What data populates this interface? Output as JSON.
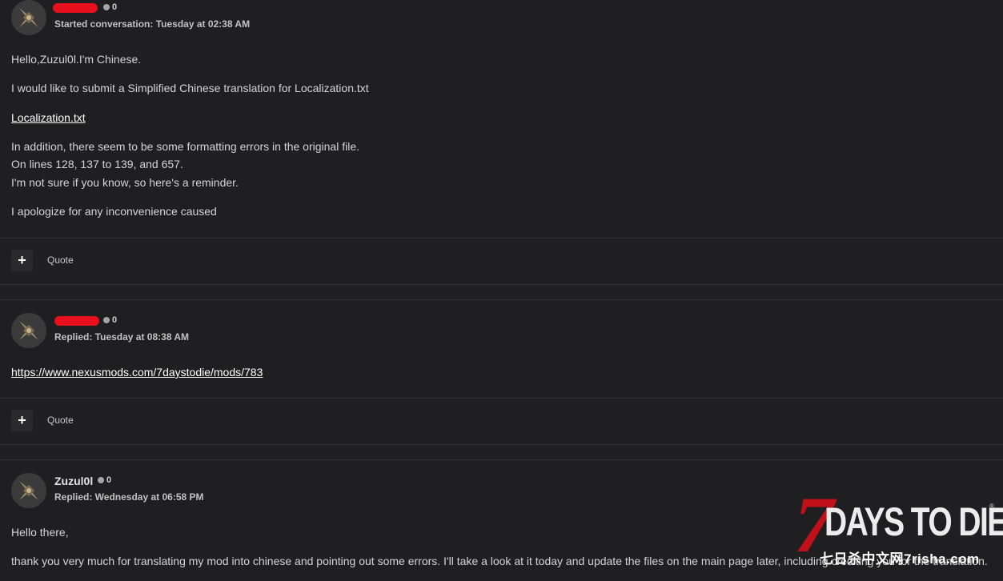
{
  "posts": [
    {
      "author": "",
      "reactions": "0",
      "meta": "Started conversation: Tuesday at 02:38 AM",
      "paragraphs": [
        "Hello,Zuzul0l.I'm Chinese.",
        "I would like to submit a Simplified Chinese translation for Localization.txt"
      ],
      "attachment_link": "Localization.txt",
      "body_lines": [
        "In addition, there seem to be some formatting errors in the original file.",
        "On lines 128, 137 to 139, and 657.",
        "I'm not sure if you know, so here's a reminder."
      ],
      "closing": "I apologize for any inconvenience caused",
      "plus_label": "+",
      "quote_label": "Quote"
    },
    {
      "author": "",
      "reactions": "0",
      "meta": "Replied: Tuesday at 08:38 AM",
      "link": "https://www.nexusmods.com/7daystodie/mods/783",
      "plus_label": "+",
      "quote_label": "Quote"
    },
    {
      "author": "Zuzul0l",
      "reactions": "0",
      "meta": "Replied: Wednesday at 06:58 PM",
      "greeting": "Hello there,",
      "body": "thank you very much for translating my mod into chinese and pointing out some errors. I'll take a look at it today and update the files on the main page later, including crediting you for the translation."
    }
  ],
  "watermark": {
    "seven": "7",
    "title": "DAYS TO DIE",
    "reg": "®",
    "subtitle": "七日杀中文网7risha.com"
  },
  "colors": {
    "background": "#1f1f21",
    "redaction": "#e8101c",
    "logo_red": "#c0111a"
  }
}
